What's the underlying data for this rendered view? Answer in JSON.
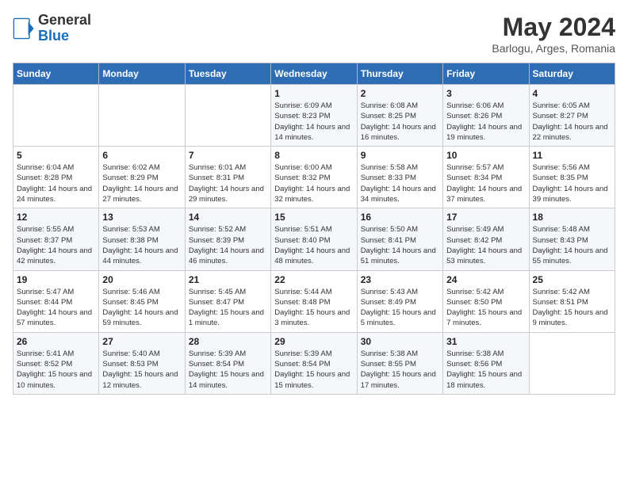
{
  "logo": {
    "general": "General",
    "blue": "Blue"
  },
  "header": {
    "month": "May 2024",
    "location": "Barlogu, Arges, Romania"
  },
  "weekdays": [
    "Sunday",
    "Monday",
    "Tuesday",
    "Wednesday",
    "Thursday",
    "Friday",
    "Saturday"
  ],
  "weeks": [
    [
      {
        "day": "",
        "sunrise": "",
        "sunset": "",
        "daylight": ""
      },
      {
        "day": "",
        "sunrise": "",
        "sunset": "",
        "daylight": ""
      },
      {
        "day": "",
        "sunrise": "",
        "sunset": "",
        "daylight": ""
      },
      {
        "day": "1",
        "sunrise": "Sunrise: 6:09 AM",
        "sunset": "Sunset: 8:23 PM",
        "daylight": "Daylight: 14 hours and 14 minutes."
      },
      {
        "day": "2",
        "sunrise": "Sunrise: 6:08 AM",
        "sunset": "Sunset: 8:25 PM",
        "daylight": "Daylight: 14 hours and 16 minutes."
      },
      {
        "day": "3",
        "sunrise": "Sunrise: 6:06 AM",
        "sunset": "Sunset: 8:26 PM",
        "daylight": "Daylight: 14 hours and 19 minutes."
      },
      {
        "day": "4",
        "sunrise": "Sunrise: 6:05 AM",
        "sunset": "Sunset: 8:27 PM",
        "daylight": "Daylight: 14 hours and 22 minutes."
      }
    ],
    [
      {
        "day": "5",
        "sunrise": "Sunrise: 6:04 AM",
        "sunset": "Sunset: 8:28 PM",
        "daylight": "Daylight: 14 hours and 24 minutes."
      },
      {
        "day": "6",
        "sunrise": "Sunrise: 6:02 AM",
        "sunset": "Sunset: 8:29 PM",
        "daylight": "Daylight: 14 hours and 27 minutes."
      },
      {
        "day": "7",
        "sunrise": "Sunrise: 6:01 AM",
        "sunset": "Sunset: 8:31 PM",
        "daylight": "Daylight: 14 hours and 29 minutes."
      },
      {
        "day": "8",
        "sunrise": "Sunrise: 6:00 AM",
        "sunset": "Sunset: 8:32 PM",
        "daylight": "Daylight: 14 hours and 32 minutes."
      },
      {
        "day": "9",
        "sunrise": "Sunrise: 5:58 AM",
        "sunset": "Sunset: 8:33 PM",
        "daylight": "Daylight: 14 hours and 34 minutes."
      },
      {
        "day": "10",
        "sunrise": "Sunrise: 5:57 AM",
        "sunset": "Sunset: 8:34 PM",
        "daylight": "Daylight: 14 hours and 37 minutes."
      },
      {
        "day": "11",
        "sunrise": "Sunrise: 5:56 AM",
        "sunset": "Sunset: 8:35 PM",
        "daylight": "Daylight: 14 hours and 39 minutes."
      }
    ],
    [
      {
        "day": "12",
        "sunrise": "Sunrise: 5:55 AM",
        "sunset": "Sunset: 8:37 PM",
        "daylight": "Daylight: 14 hours and 42 minutes."
      },
      {
        "day": "13",
        "sunrise": "Sunrise: 5:53 AM",
        "sunset": "Sunset: 8:38 PM",
        "daylight": "Daylight: 14 hours and 44 minutes."
      },
      {
        "day": "14",
        "sunrise": "Sunrise: 5:52 AM",
        "sunset": "Sunset: 8:39 PM",
        "daylight": "Daylight: 14 hours and 46 minutes."
      },
      {
        "day": "15",
        "sunrise": "Sunrise: 5:51 AM",
        "sunset": "Sunset: 8:40 PM",
        "daylight": "Daylight: 14 hours and 48 minutes."
      },
      {
        "day": "16",
        "sunrise": "Sunrise: 5:50 AM",
        "sunset": "Sunset: 8:41 PM",
        "daylight": "Daylight: 14 hours and 51 minutes."
      },
      {
        "day": "17",
        "sunrise": "Sunrise: 5:49 AM",
        "sunset": "Sunset: 8:42 PM",
        "daylight": "Daylight: 14 hours and 53 minutes."
      },
      {
        "day": "18",
        "sunrise": "Sunrise: 5:48 AM",
        "sunset": "Sunset: 8:43 PM",
        "daylight": "Daylight: 14 hours and 55 minutes."
      }
    ],
    [
      {
        "day": "19",
        "sunrise": "Sunrise: 5:47 AM",
        "sunset": "Sunset: 8:44 PM",
        "daylight": "Daylight: 14 hours and 57 minutes."
      },
      {
        "day": "20",
        "sunrise": "Sunrise: 5:46 AM",
        "sunset": "Sunset: 8:45 PM",
        "daylight": "Daylight: 14 hours and 59 minutes."
      },
      {
        "day": "21",
        "sunrise": "Sunrise: 5:45 AM",
        "sunset": "Sunset: 8:47 PM",
        "daylight": "Daylight: 15 hours and 1 minute."
      },
      {
        "day": "22",
        "sunrise": "Sunrise: 5:44 AM",
        "sunset": "Sunset: 8:48 PM",
        "daylight": "Daylight: 15 hours and 3 minutes."
      },
      {
        "day": "23",
        "sunrise": "Sunrise: 5:43 AM",
        "sunset": "Sunset: 8:49 PM",
        "daylight": "Daylight: 15 hours and 5 minutes."
      },
      {
        "day": "24",
        "sunrise": "Sunrise: 5:42 AM",
        "sunset": "Sunset: 8:50 PM",
        "daylight": "Daylight: 15 hours and 7 minutes."
      },
      {
        "day": "25",
        "sunrise": "Sunrise: 5:42 AM",
        "sunset": "Sunset: 8:51 PM",
        "daylight": "Daylight: 15 hours and 9 minutes."
      }
    ],
    [
      {
        "day": "26",
        "sunrise": "Sunrise: 5:41 AM",
        "sunset": "Sunset: 8:52 PM",
        "daylight": "Daylight: 15 hours and 10 minutes."
      },
      {
        "day": "27",
        "sunrise": "Sunrise: 5:40 AM",
        "sunset": "Sunset: 8:53 PM",
        "daylight": "Daylight: 15 hours and 12 minutes."
      },
      {
        "day": "28",
        "sunrise": "Sunrise: 5:39 AM",
        "sunset": "Sunset: 8:54 PM",
        "daylight": "Daylight: 15 hours and 14 minutes."
      },
      {
        "day": "29",
        "sunrise": "Sunrise: 5:39 AM",
        "sunset": "Sunset: 8:54 PM",
        "daylight": "Daylight: 15 hours and 15 minutes."
      },
      {
        "day": "30",
        "sunrise": "Sunrise: 5:38 AM",
        "sunset": "Sunset: 8:55 PM",
        "daylight": "Daylight: 15 hours and 17 minutes."
      },
      {
        "day": "31",
        "sunrise": "Sunrise: 5:38 AM",
        "sunset": "Sunset: 8:56 PM",
        "daylight": "Daylight: 15 hours and 18 minutes."
      },
      {
        "day": "",
        "sunrise": "",
        "sunset": "",
        "daylight": ""
      }
    ]
  ]
}
